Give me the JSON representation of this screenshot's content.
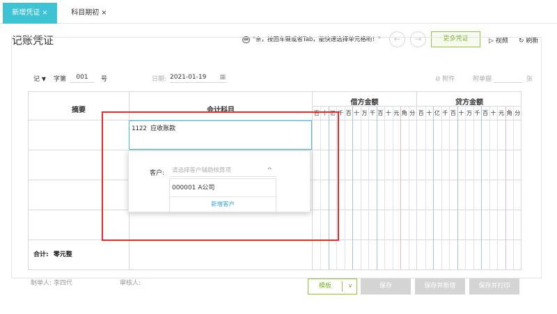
{
  "tabs": [
    {
      "label": "新增凭证",
      "close": "×"
    },
    {
      "label": "科目期初",
      "close": "×"
    }
  ],
  "page": {
    "title": "记账凭证"
  },
  "toolbar": {
    "kbd_icon": "⌨",
    "tip": "\"亲，按回车键或者Tab，能快速选择单元格哟！\"",
    "prev": "←",
    "next": "→",
    "more_vouchers": "更多凭证",
    "video": "视频",
    "refresh": "刷新",
    "video_icon": "▷",
    "refresh_icon": "↻"
  },
  "voucher_header": {
    "type_value": "记",
    "type_caret": "▼",
    "zi_label": "字第",
    "number": "001",
    "hao": "号",
    "date_label": "日期:",
    "date_value": "2021-01-19",
    "calendar_icon": "▦",
    "attach_icon": "⊘",
    "attach_label": "附件",
    "attach_count_label": "附单据",
    "attach_unit": "张"
  },
  "table": {
    "col_summary": "摘要",
    "col_subject": "会计科目",
    "col_debit": "借方金额",
    "col_credit": "贷方金额",
    "digits": [
      "百",
      "十",
      "亿",
      "千",
      "百",
      "十",
      "万",
      "千",
      "百",
      "十",
      "元",
      "角",
      "分"
    ],
    "subject_value": "1122  应收账款",
    "total_label": "合计:",
    "total_value": "零元整"
  },
  "popup": {
    "customer_label": "客户:",
    "customer_placeholder": "请选择客户辅助核算项",
    "caret": "^",
    "options": [
      "000001 A公司"
    ],
    "add_customer": "新增客户"
  },
  "footer": {
    "preparer_label": "制单人:",
    "preparer": "李四代",
    "reviewer_label": "审核人:",
    "template": "模板",
    "template_caret": "∨",
    "save": "保存",
    "save_new": "保存并新增",
    "save_print": "保存并打印"
  },
  "colors": {
    "accent_teal": "#3dc3d3",
    "accent_green": "#8cc63f",
    "highlight_red": "#e22b2b",
    "link_blue": "#3aa6d6"
  }
}
